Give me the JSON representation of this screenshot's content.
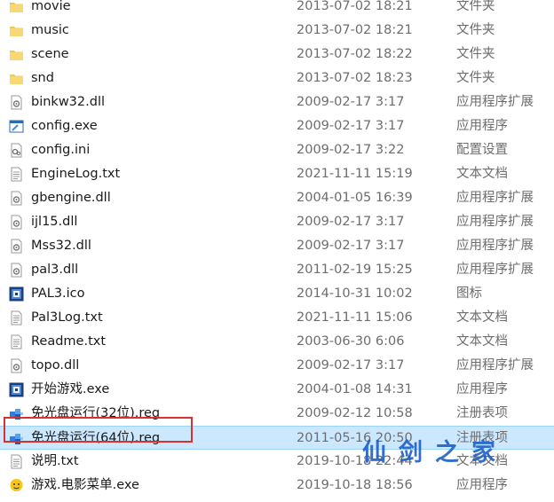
{
  "files": [
    {
      "name": "movie",
      "date": "2013-07-02 18:21",
      "type": "文件夹",
      "icon": "folder-icon",
      "selected": false
    },
    {
      "name": "music",
      "date": "2013-07-02 18:21",
      "type": "文件夹",
      "icon": "folder-icon",
      "selected": false
    },
    {
      "name": "scene",
      "date": "2013-07-02 18:22",
      "type": "文件夹",
      "icon": "folder-icon",
      "selected": false
    },
    {
      "name": "snd",
      "date": "2013-07-02 18:23",
      "type": "文件夹",
      "icon": "folder-icon",
      "selected": false
    },
    {
      "name": "binkw32.dll",
      "date": "2009-02-17 3:17",
      "type": "应用程序扩展",
      "icon": "dll-icon",
      "selected": false
    },
    {
      "name": "config.exe",
      "date": "2009-02-17 3:17",
      "type": "应用程序",
      "icon": "exe-icon",
      "selected": false
    },
    {
      "name": "config.ini",
      "date": "2009-02-17 3:22",
      "type": "配置设置",
      "icon": "ini-icon",
      "selected": false
    },
    {
      "name": "EngineLog.txt",
      "date": "2021-11-11 15:19",
      "type": "文本文档",
      "icon": "txt-icon",
      "selected": false
    },
    {
      "name": "gbengine.dll",
      "date": "2004-01-05 16:39",
      "type": "应用程序扩展",
      "icon": "dll-icon",
      "selected": false
    },
    {
      "name": "ijl15.dll",
      "date": "2009-02-17 3:17",
      "type": "应用程序扩展",
      "icon": "dll-icon",
      "selected": false
    },
    {
      "name": "Mss32.dll",
      "date": "2009-02-17 3:17",
      "type": "应用程序扩展",
      "icon": "dll-icon",
      "selected": false
    },
    {
      "name": "pal3.dll",
      "date": "2011-02-19 15:25",
      "type": "应用程序扩展",
      "icon": "dll-icon",
      "selected": false
    },
    {
      "name": "PAL3.ico",
      "date": "2014-10-31 10:02",
      "type": "图标",
      "icon": "pal-icon",
      "selected": false
    },
    {
      "name": "Pal3Log.txt",
      "date": "2021-11-11 15:06",
      "type": "文本文档",
      "icon": "txt-icon",
      "selected": false
    },
    {
      "name": "Readme.txt",
      "date": "2003-06-30 6:06",
      "type": "文本文档",
      "icon": "txt-icon",
      "selected": false
    },
    {
      "name": "topo.dll",
      "date": "2009-02-17 3:17",
      "type": "应用程序扩展",
      "icon": "dll-icon",
      "selected": false
    },
    {
      "name": "开始游戏.exe",
      "date": "2004-01-08 14:31",
      "type": "应用程序",
      "icon": "pal-icon",
      "selected": false
    },
    {
      "name": "免光盘运行(32位).reg",
      "date": "2009-02-12 10:58",
      "type": "注册表项",
      "icon": "reg-icon",
      "selected": false
    },
    {
      "name": "免光盘运行(64位).reg",
      "date": "2011-05-16 20:50",
      "type": "注册表项",
      "icon": "reg-icon",
      "selected": true
    },
    {
      "name": "说明.txt",
      "date": "2019-10-18 22:44",
      "type": "文本文档",
      "icon": "txt-icon",
      "selected": false
    },
    {
      "name": "游戏.电影菜单.exe",
      "date": "2019-10-18 18:56",
      "type": "应用程序",
      "icon": "app-face-icon",
      "selected": false
    }
  ],
  "watermark": "仙剑之家",
  "colors": {
    "selection_bg": "#cce8ff",
    "highlight_border": "#d93030",
    "folder": "#f2c94c",
    "watermark": "#1e5fc8"
  }
}
